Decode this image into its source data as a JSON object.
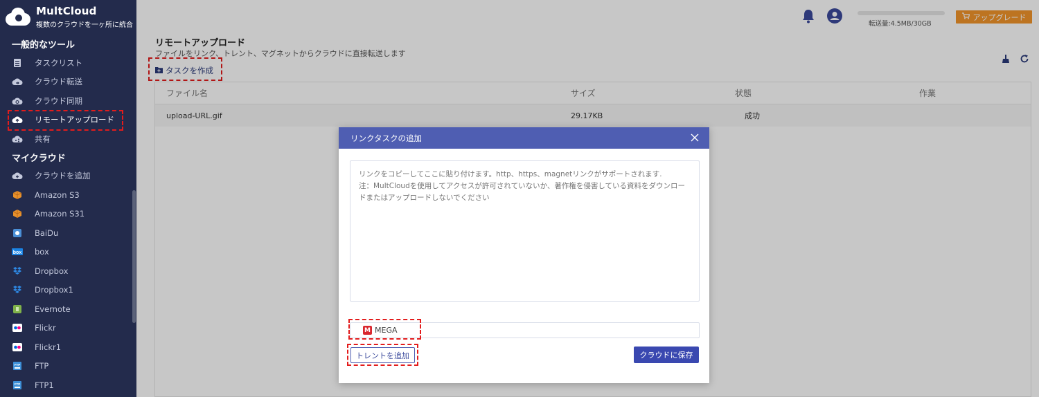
{
  "app": {
    "name": "MultCloud",
    "tagline": "複数のクラウドを一ヶ所に統合"
  },
  "sidebar": {
    "general_title": "一般的なツール",
    "general_items": [
      {
        "label": "タスクリスト",
        "icon": "task-list-icon"
      },
      {
        "label": "クラウド転送",
        "icon": "cloud-transfer-icon"
      },
      {
        "label": "クラウド同期",
        "icon": "cloud-sync-icon"
      },
      {
        "label": "リモートアップロード",
        "icon": "remote-upload-icon",
        "active": true
      },
      {
        "label": "共有",
        "icon": "share-icon"
      }
    ],
    "my_cloud_title": "マイクラウド",
    "cloud_items": [
      {
        "label": "クラウドを追加",
        "icon": "add-cloud-icon"
      },
      {
        "label": "Amazon S3",
        "icon": "amazon-s3-icon"
      },
      {
        "label": "Amazon S31",
        "icon": "amazon-s3-icon"
      },
      {
        "label": "BaiDu",
        "icon": "baidu-icon"
      },
      {
        "label": "box",
        "icon": "box-icon"
      },
      {
        "label": "Dropbox",
        "icon": "dropbox-icon"
      },
      {
        "label": "Dropbox1",
        "icon": "dropbox-icon"
      },
      {
        "label": "Evernote",
        "icon": "evernote-icon"
      },
      {
        "label": "Flickr",
        "icon": "flickr-icon"
      },
      {
        "label": "Flickr1",
        "icon": "flickr-icon"
      },
      {
        "label": "FTP",
        "icon": "ftp-icon"
      },
      {
        "label": "FTP1",
        "icon": "ftp-icon"
      }
    ]
  },
  "topbar": {
    "quota": "転送量:4.5MB/30GB",
    "upgrade_label": "アップグレード"
  },
  "page": {
    "title": "リモートアップロード",
    "description": "ファイルをリンク、トレント、マグネットからクラウドに直接転送します",
    "create_task_label": "タスクを作成"
  },
  "table": {
    "headers": [
      "ファイル名",
      "サイズ",
      "状態",
      "作業"
    ],
    "rows": [
      {
        "name": "upload-URL.gif",
        "size": "29.17KB",
        "status": "成功",
        "action": ""
      }
    ]
  },
  "modal": {
    "title": "リンクタスクの追加",
    "textarea_placeholder": "リンクをコピーしてここに貼り付けます。http、https、magnetリンクがサポートされます.\n注：MultCloudを使用してアクセスが許可されていないか、著作権を侵害している資料をダウンロードまたはアップロードしないでください",
    "destination": "MEGA",
    "add_torrent_label": "トレントを追加",
    "save_label": "クラウドに保存"
  },
  "colors": {
    "sidebar_bg": "#232b4c",
    "modal_header": "#4f5eb2",
    "primary_button": "#3a48b0",
    "upgrade_button": "#f3952b",
    "highlight": "#e31c1c",
    "mega_red": "#d9272e"
  }
}
